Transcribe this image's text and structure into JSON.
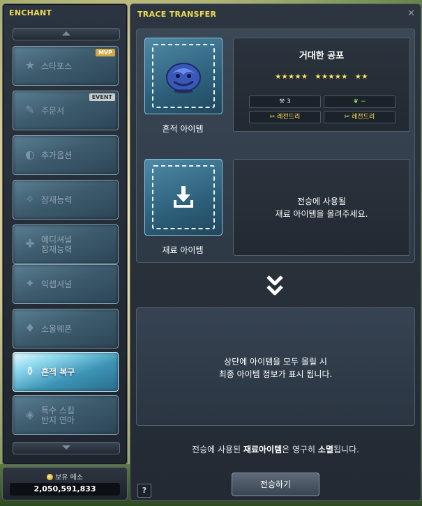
{
  "enchant": {
    "title": "ENCHANT",
    "items": [
      {
        "label": "스타포스",
        "badge": "MVP",
        "icon": "star-icon"
      },
      {
        "label": "주문서",
        "badge": "EVENT",
        "icon": "scroll-icon"
      },
      {
        "label": "추가옵션",
        "icon": "flame-option-icon"
      },
      {
        "label": "잠재능력",
        "icon": "potential-icon"
      },
      {
        "label": "에디셔널\n잠재능력",
        "icon": "additional-potential-icon"
      },
      {
        "label": "익셉셔널",
        "icon": "exceptional-icon"
      },
      {
        "label": "소울웨폰",
        "icon": "soul-icon"
      },
      {
        "label": "흔적 복구",
        "icon": "trace-restore-icon",
        "active": true
      },
      {
        "label": "특수 스킬\n반지 연마",
        "icon": "ring-icon"
      }
    ],
    "meso": {
      "label": "보유 메소",
      "value": "2,050,591,833"
    }
  },
  "trace": {
    "title": "TRACE TRANSFER",
    "trace_slot_label": "흔적 아이템",
    "material_slot_label": "재료 아이템",
    "item": {
      "name": "거대한 공포",
      "stars": [
        "★★★★★",
        "★★★★★",
        "★★"
      ],
      "stat_count": "3",
      "stat_extra": "−",
      "grade_left": "레전드리",
      "grade_right": "레전드리"
    },
    "material_message": "전승에 사용될\n재료 아이템을 올려주세요.",
    "result_message": "상단에 아이템을 모두 올릴 시\n최종 아이템 정보가 표시 됩니다.",
    "warning": {
      "prefix": "전승에 사용된 ",
      "highlight1": "재료아이템",
      "middle": "은 영구히 ",
      "highlight2": "소멸",
      "suffix": "됩니다."
    },
    "help_label": "?",
    "transfer_button": "전승하기"
  },
  "colors": {
    "title_accent": "#f1dc56",
    "star": "#ffe15c",
    "legendary": "#ffe15c",
    "green": "#7fe06f"
  }
}
